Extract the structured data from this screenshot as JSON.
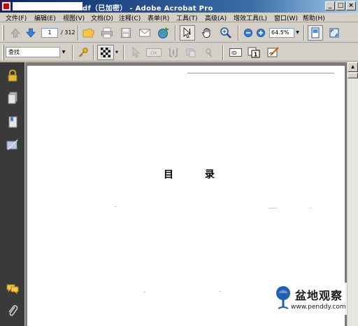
{
  "window": {
    "title": "df（已加密） - Adobe Acrobat Pro",
    "buttons": {
      "minimize": "_",
      "maximize": "□",
      "close": "×"
    }
  },
  "menu": [
    "文件(F)",
    "编辑(E)",
    "视图(V)",
    "文档(D)",
    "注释(C)",
    "表单(R)",
    "工具(T)",
    "高级(A)",
    "增效工具(L)",
    "窗口(W)",
    "帮助(H)"
  ],
  "navigation": {
    "current_page": "1",
    "total_pages": "/ 312"
  },
  "zoom": {
    "value": "64.5%"
  },
  "find": {
    "placeholder": "查找"
  },
  "document": {
    "heading": "目 录"
  },
  "watermark": {
    "site_name": "盆地观察",
    "url": "www.penddy.com"
  },
  "colors": {
    "title_bar_start": "#0a246a",
    "title_bar_end": "#a6caf0",
    "nav_panel": "#3a3a3a",
    "doc_background": "#7a7a7a"
  },
  "icons": [
    "previous-page-icon",
    "next-page-icon",
    "open-folder-icon",
    "print-icon",
    "save-icon",
    "email-icon",
    "web-globe-icon",
    "select-cursor-icon",
    "hand-tool-icon",
    "zoom-icon",
    "zoom-out-icon",
    "zoom-in-icon",
    "single-page-icon",
    "full-screen-icon",
    "key-icon",
    "checkerboard-icon",
    "lock-icon",
    "pages-icon",
    "attachments-icon",
    "comments-icon",
    "paperclip-icon"
  ]
}
